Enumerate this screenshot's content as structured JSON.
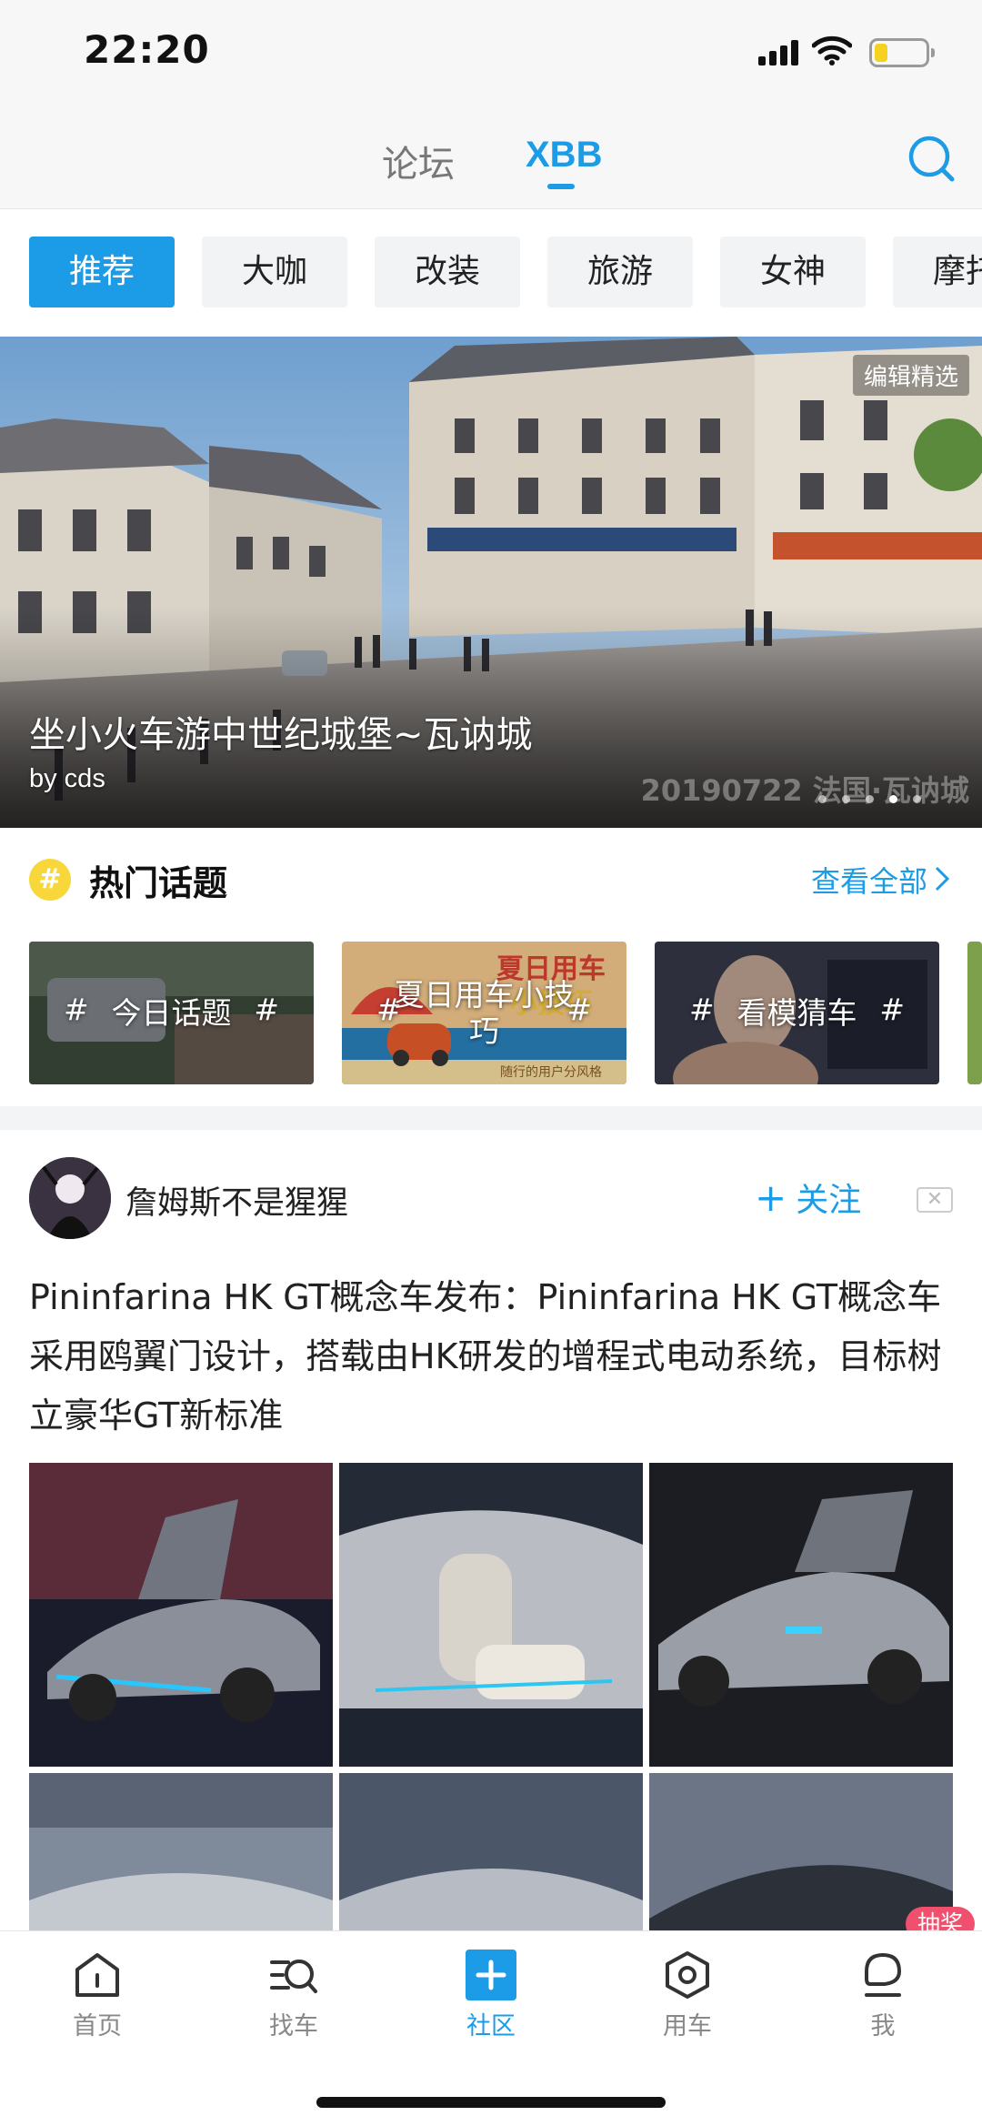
{
  "status_bar": {
    "time": "22:20",
    "battery_level": 0.25
  },
  "header": {
    "tabs": [
      {
        "label": "论坛",
        "active": false
      },
      {
        "label": "XBB",
        "active": true
      }
    ]
  },
  "categories": [
    "推荐",
    "大咖",
    "改装",
    "旅游",
    "女神",
    "摩托"
  ],
  "banner": {
    "badge": "编辑精选",
    "title": "坐小火车游中世纪城堡~瓦讷城",
    "author": "by cds",
    "watermark": "20190722 法国·瓦讷城",
    "slide_count": 5,
    "active_slide": 4
  },
  "hot_topics": {
    "title": "热门话题",
    "view_all": "查看全部",
    "items": [
      {
        "label": "今日话题"
      },
      {
        "label": "夏日用车小技巧",
        "overlay": "夏日用车 小技巧",
        "sub": "随行的用户分风格"
      },
      {
        "label": "看模猜车"
      }
    ]
  },
  "post": {
    "author": "詹姆斯不是猩猩",
    "follow_label": "关注",
    "text": "Pininfarina HK GT概念车发布：Pininfarina HK GT概念车采用鸥翼门设计，搭载由HK研发的增程式电动系统，目标树立豪华GT新标准"
  },
  "lottery_label": "抽奖",
  "bottom_nav": [
    {
      "label": "首页",
      "icon": "home-icon",
      "active": false
    },
    {
      "label": "找车",
      "icon": "find-car-icon",
      "active": false
    },
    {
      "label": "社区",
      "icon": "community-plus-icon",
      "active": true
    },
    {
      "label": "用车",
      "icon": "car-use-icon",
      "active": false
    },
    {
      "label": "我",
      "icon": "profile-icon",
      "active": false
    }
  ],
  "colors": {
    "accent": "#1c9ce6",
    "topic_icon": "#f8d73a",
    "lottery": "#f0506e"
  }
}
